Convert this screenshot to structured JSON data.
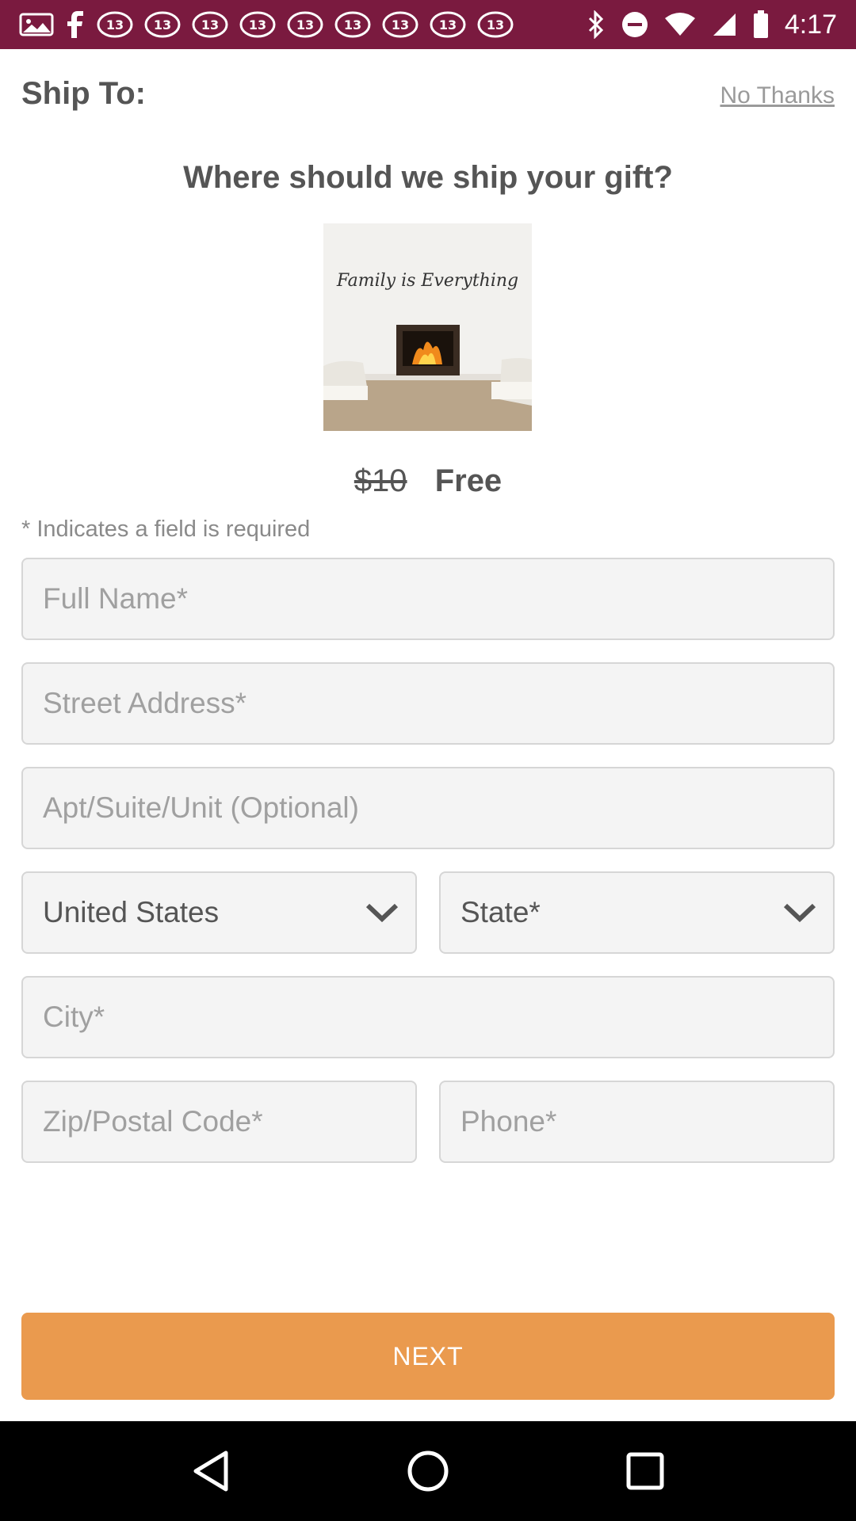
{
  "status_bar": {
    "time": "4:17",
    "left_icons": [
      "gallery-icon",
      "facebook-icon",
      "abc13-icon",
      "abc13-icon",
      "abc13-icon",
      "abc13-icon",
      "abc13-icon",
      "abc13-icon",
      "abc13-icon",
      "abc13-icon",
      "abc13-icon"
    ],
    "right_icons": [
      "bluetooth-icon",
      "dnd-icon",
      "wifi-icon",
      "signal-icon",
      "battery-icon"
    ],
    "background": "#7a1a3f"
  },
  "header": {
    "title": "Ship To:",
    "no_thanks": "No Thanks"
  },
  "question": "Where should we ship your gift?",
  "product": {
    "image_caption": "Family is Everything"
  },
  "price": {
    "old": "$10",
    "new": "Free"
  },
  "required_note": "* Indicates a field is required",
  "form": {
    "full_name_placeholder": "Full Name*",
    "street_placeholder": "Street Address*",
    "apt_placeholder": "Apt/Suite/Unit (Optional)",
    "country_value": "United States",
    "state_value": "State*",
    "city_placeholder": "City*",
    "zip_placeholder": "Zip/Postal Code*",
    "phone_placeholder": "Phone*"
  },
  "next_button": "NEXT",
  "accent_color": "#ea9a4e",
  "nav": [
    "back-icon",
    "home-icon",
    "recents-icon"
  ]
}
